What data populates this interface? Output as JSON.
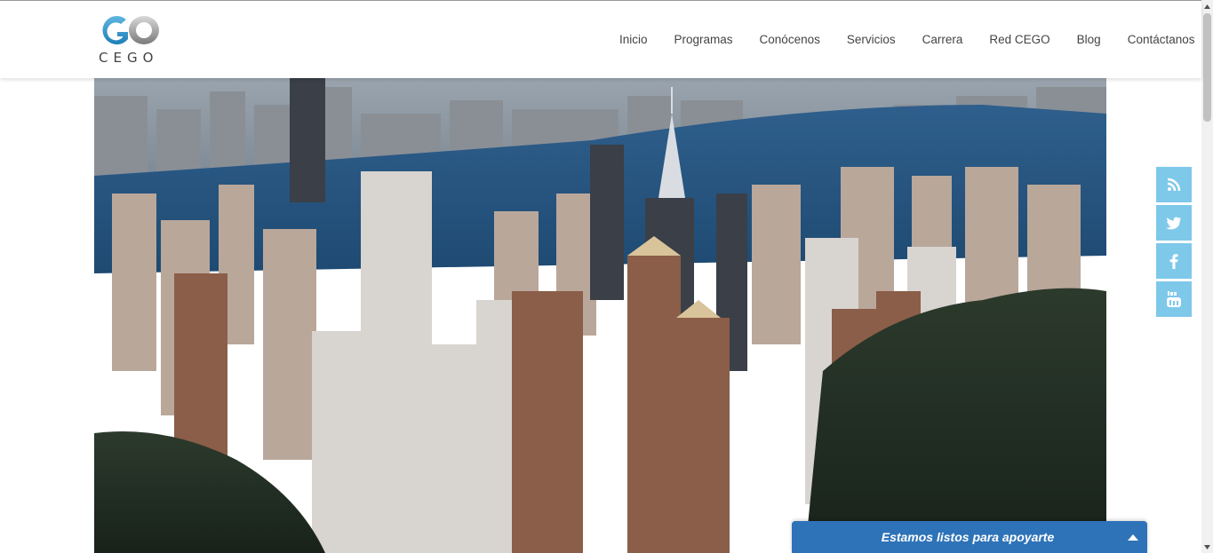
{
  "brand": {
    "logo_mark": "GO",
    "logo_text": "CEGO"
  },
  "nav": {
    "items": [
      {
        "label": "Inicio"
      },
      {
        "label": "Programas"
      },
      {
        "label": "Conócenos"
      },
      {
        "label": "Servicios"
      },
      {
        "label": "Carrera"
      },
      {
        "label": "Red CEGO"
      },
      {
        "label": "Blog"
      },
      {
        "label": "Contáctanos"
      }
    ]
  },
  "hero": {
    "image": "city-skyline-aerial-photo"
  },
  "social": {
    "color": "#7ec8ea",
    "items": [
      {
        "icon": "rss-icon"
      },
      {
        "icon": "twitter-icon"
      },
      {
        "icon": "facebook-icon"
      },
      {
        "icon": "youtube-icon"
      }
    ]
  },
  "chat": {
    "title": "Estamos listos para apoyarte",
    "color": "#2e73b8"
  }
}
